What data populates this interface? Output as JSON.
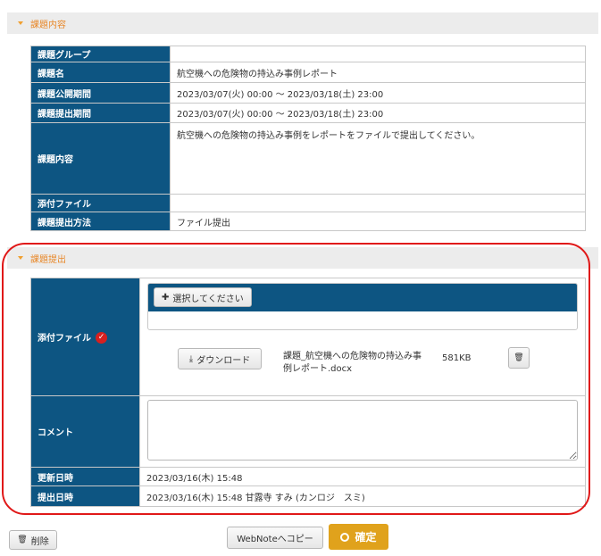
{
  "assignment_section": {
    "title": "課題内容",
    "rows": [
      {
        "label": "課題グループ",
        "value": ""
      },
      {
        "label": "課題名",
        "value": "航空機への危険物の持込み事例レポート"
      },
      {
        "label": "課題公開期間",
        "value": "2023/03/07(火) 00:00 ～ 2023/03/18(土) 23:00"
      },
      {
        "label": "課題提出期間",
        "value": "2023/03/07(火) 00:00 ～ 2023/03/18(土) 23:00"
      },
      {
        "label": "課題内容",
        "value": "航空機への危険物の持込み事例をレポートをファイルで提出してください。"
      },
      {
        "label": "添付ファイル",
        "value": ""
      },
      {
        "label": "課題提出方法",
        "value": "ファイル提出"
      }
    ]
  },
  "submission_section": {
    "title": "課題提出",
    "attachment_label": "添付ファイル",
    "required_mark": "✓",
    "select_button": "選択してください",
    "select_icon": "plus-icon",
    "download_button": "ダウンロード",
    "download_icon": "download-icon",
    "file_name": "課題_航空機への危険物の持込み事例レポート.docx",
    "file_size": "581KB",
    "trash_icon": "trash-icon",
    "comment_label": "コメント",
    "comment_value": "",
    "updated_label": "更新日時",
    "updated_value": "2023/03/16(木) 15:48",
    "submitted_label": "提出日時",
    "submitted_value": "2023/03/16(木) 15:48 甘露寺 すみ (カンロジ　スミ)"
  },
  "footer": {
    "delete_button": "削除",
    "webnote_button": "WebNoteへコピー",
    "confirm_button": "確定"
  },
  "colors": {
    "label_bg": "#0d5582",
    "accent_orange": "#e8892b",
    "confirm_bg": "#e0a21c",
    "highlight_red": "#e01818"
  }
}
